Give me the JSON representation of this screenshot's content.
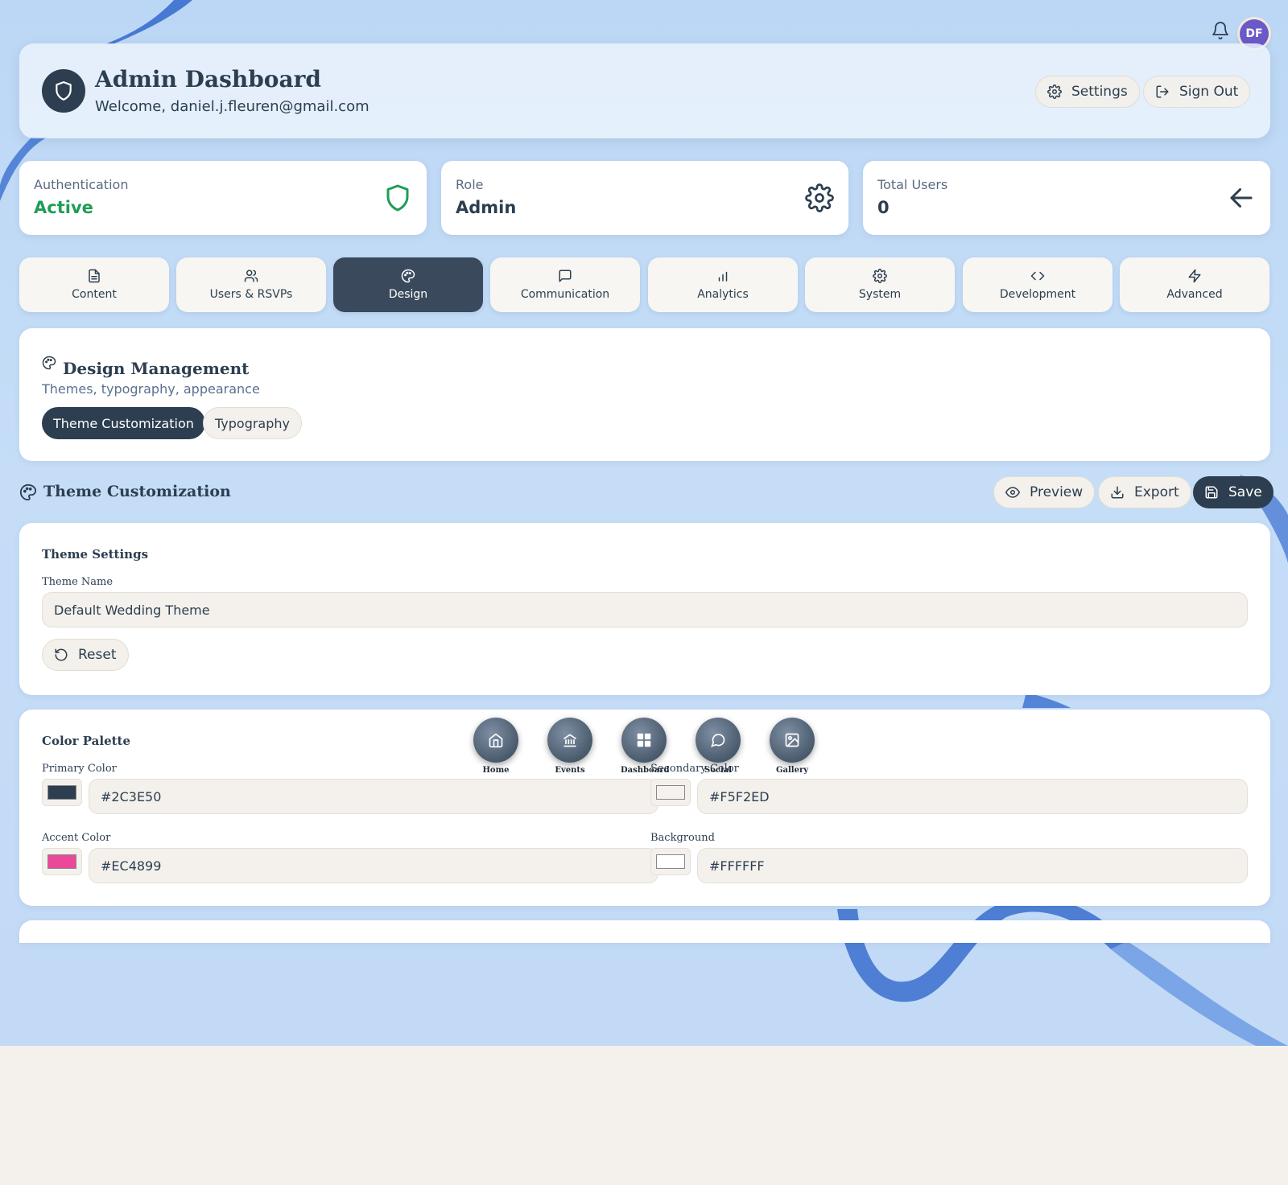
{
  "header": {
    "title": "Admin Dashboard",
    "welcome": "Welcome, daniel.j.fleuren@gmail.com",
    "settings_label": "Settings",
    "signout_label": "Sign Out"
  },
  "user": {
    "initials": "DF"
  },
  "stats": [
    {
      "label": "Authentication",
      "value": "Active",
      "color": "#1f9d55"
    },
    {
      "label": "Role",
      "value": "Admin"
    },
    {
      "label": "Total Users",
      "value": "0"
    }
  ],
  "tabs": [
    {
      "label": "Content",
      "icon": "document-icon"
    },
    {
      "label": "Users & RSVPs",
      "icon": "users-icon"
    },
    {
      "label": "Design",
      "icon": "palette-icon",
      "active": true
    },
    {
      "label": "Communication",
      "icon": "chat-icon"
    },
    {
      "label": "Analytics",
      "icon": "bar-chart-icon"
    },
    {
      "label": "System",
      "icon": "gear-icon"
    },
    {
      "label": "Development",
      "icon": "code-icon"
    },
    {
      "label": "Advanced",
      "icon": "lightning-icon"
    }
  ],
  "design": {
    "title": "Design Management",
    "subtitle": "Themes, typography, appearance",
    "subtabs": [
      "Theme Customization",
      "Typography"
    ]
  },
  "theme": {
    "section_title": "Theme Customization",
    "preview_label": "Preview",
    "export_label": "Export",
    "save_label": "Save",
    "settings_title": "Theme Settings",
    "name_label": "Theme Name",
    "name_value": "Default Wedding Theme",
    "reset_label": "Reset"
  },
  "palette": {
    "title": "Color Palette",
    "primary_label": "Primary Color",
    "primary_value": "#2C3E50",
    "secondary_label": "Secondary Color",
    "secondary_value": "#F5F2ED",
    "accent_label": "Accent Color",
    "accent_value": "#EC4899",
    "background_label": "Background",
    "background_value": "#FFFFFF"
  },
  "floating_nav": [
    {
      "label": "Home",
      "icon": "home-icon"
    },
    {
      "label": "Events",
      "icon": "bank-icon"
    },
    {
      "label": "Dashboard",
      "icon": "grid-icon"
    },
    {
      "label": "Social",
      "icon": "chat-icon"
    },
    {
      "label": "Gallery",
      "icon": "image-icon"
    }
  ],
  "colors": {
    "primary": "#2C3E50",
    "active_green": "#1F9D55",
    "avatar": "#6A5AC8"
  }
}
